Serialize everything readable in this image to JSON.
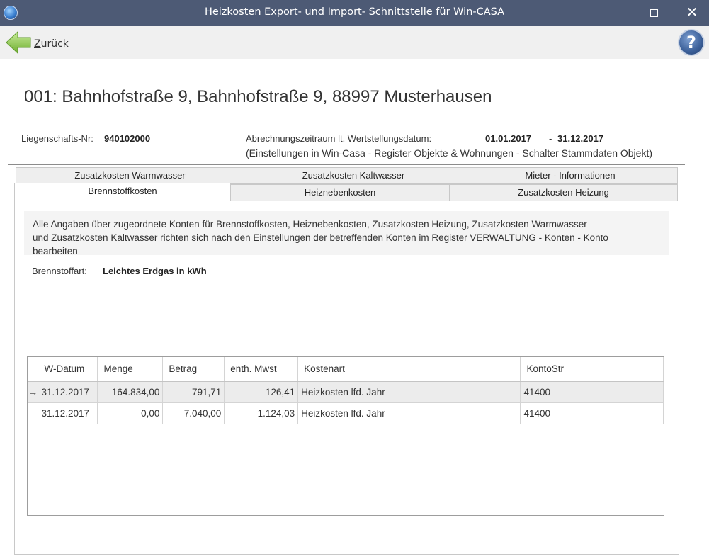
{
  "window": {
    "title": "Heizkosten Export- und Import- Schnittstelle für Win-CASA"
  },
  "toolbar": {
    "back_accel": "Z",
    "back_rest": "urück",
    "help_symbol": "?"
  },
  "object": {
    "title": "001: Bahnhofstraße 9, Bahnhofstraße 9, 88997 Musterhausen",
    "liegenschaft_label": "Liegenschafts-Nr:",
    "liegenschaft_value": "940102000",
    "zeitraum_label": "Abrechnungszeitraum lt. Wertstellungsdatum:",
    "zeitraum_from": "01.01.2017",
    "zeitraum_sep": "-",
    "zeitraum_to": "31.12.2017",
    "settings_note": "(Einstellungen in Win-Casa - Register Objekte & Wohnungen - Schalter Stammdaten Objekt)"
  },
  "tabs": {
    "back_row": [
      "Zusatzkosten Warmwasser",
      "Zusatzkosten Kaltwasser",
      "Mieter -  Informationen"
    ],
    "front_row": [
      "Brennstoffkosten",
      "Heiznebenkosten",
      "Zusatzkosten Heizung"
    ],
    "active": "Brennstoffkosten"
  },
  "panel": {
    "info_line1": "Alle Angaben über zugeordnete Konten für Brennstoffkosten, Heiznebenkosten, Zusatzkosten Heizung, Zusatzkosten Warmwasser",
    "info_line2": "und Zusatzkosten Kaltwasser richten sich nach den Einstellungen der betreffenden Konten im Register VERWALTUNG - Konten - Konto",
    "info_line3": "bearbeiten",
    "brennstoff_label": "Brennstoffart:",
    "brennstoff_value": "Leichtes Erdgas in kWh"
  },
  "grid": {
    "columns": [
      "W-Datum",
      "Menge",
      "Betrag",
      "enth. Mwst",
      "Kostenart",
      "KontoStr"
    ],
    "row_indicator": "→",
    "rows": [
      {
        "datum": "31.12.2017",
        "menge": "164.834,00",
        "betrag": "791,71",
        "mwst": "126,41",
        "kostenart": "Heizkosten lfd. Jahr",
        "konto": "41400"
      },
      {
        "datum": "31.12.2017",
        "menge": "0,00",
        "betrag": "7.040,00",
        "mwst": "1.124,03",
        "kostenart": "Heizkosten lfd. Jahr",
        "konto": "41400"
      }
    ]
  }
}
